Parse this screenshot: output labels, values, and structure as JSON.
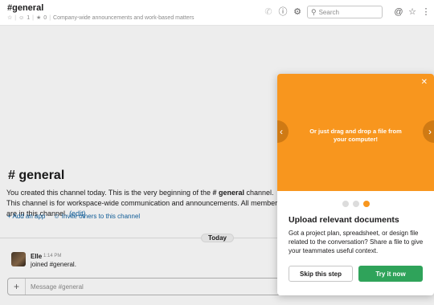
{
  "header": {
    "channel_name": "#general",
    "members_count": "1",
    "pins_count": "0",
    "topic": "Company-wide announcements and work-based matters",
    "search_placeholder": "Search"
  },
  "intro": {
    "title": "# general",
    "text_before": "You created this channel today. This is the very beginning of the ",
    "channel_bold": "# general",
    "text_after": " channel. This channel is for workspace-wide communication and announcements. All members are in this channel.",
    "edit_link": "(edit)",
    "add_app": "+ Add an app",
    "invite": "Invite others to this channel"
  },
  "day_divider": "Today",
  "message": {
    "author": "Elle",
    "time": "1:14 PM",
    "text": "joined #general."
  },
  "composer": {
    "placeholder": "Message #general"
  },
  "onboarding": {
    "hero_text": "Or just drag and drop a file from your computer!",
    "title": "Upload relevant documents",
    "body": "Got a project plan, spreadsheet, or design file related to the conversation? Share a file to give your teammates useful context.",
    "skip_label": "Skip this step",
    "try_label": "Try it now",
    "total_steps": 3,
    "active_step": 3,
    "accent_color": "#f8961e",
    "primary_color": "#2fa35a"
  }
}
